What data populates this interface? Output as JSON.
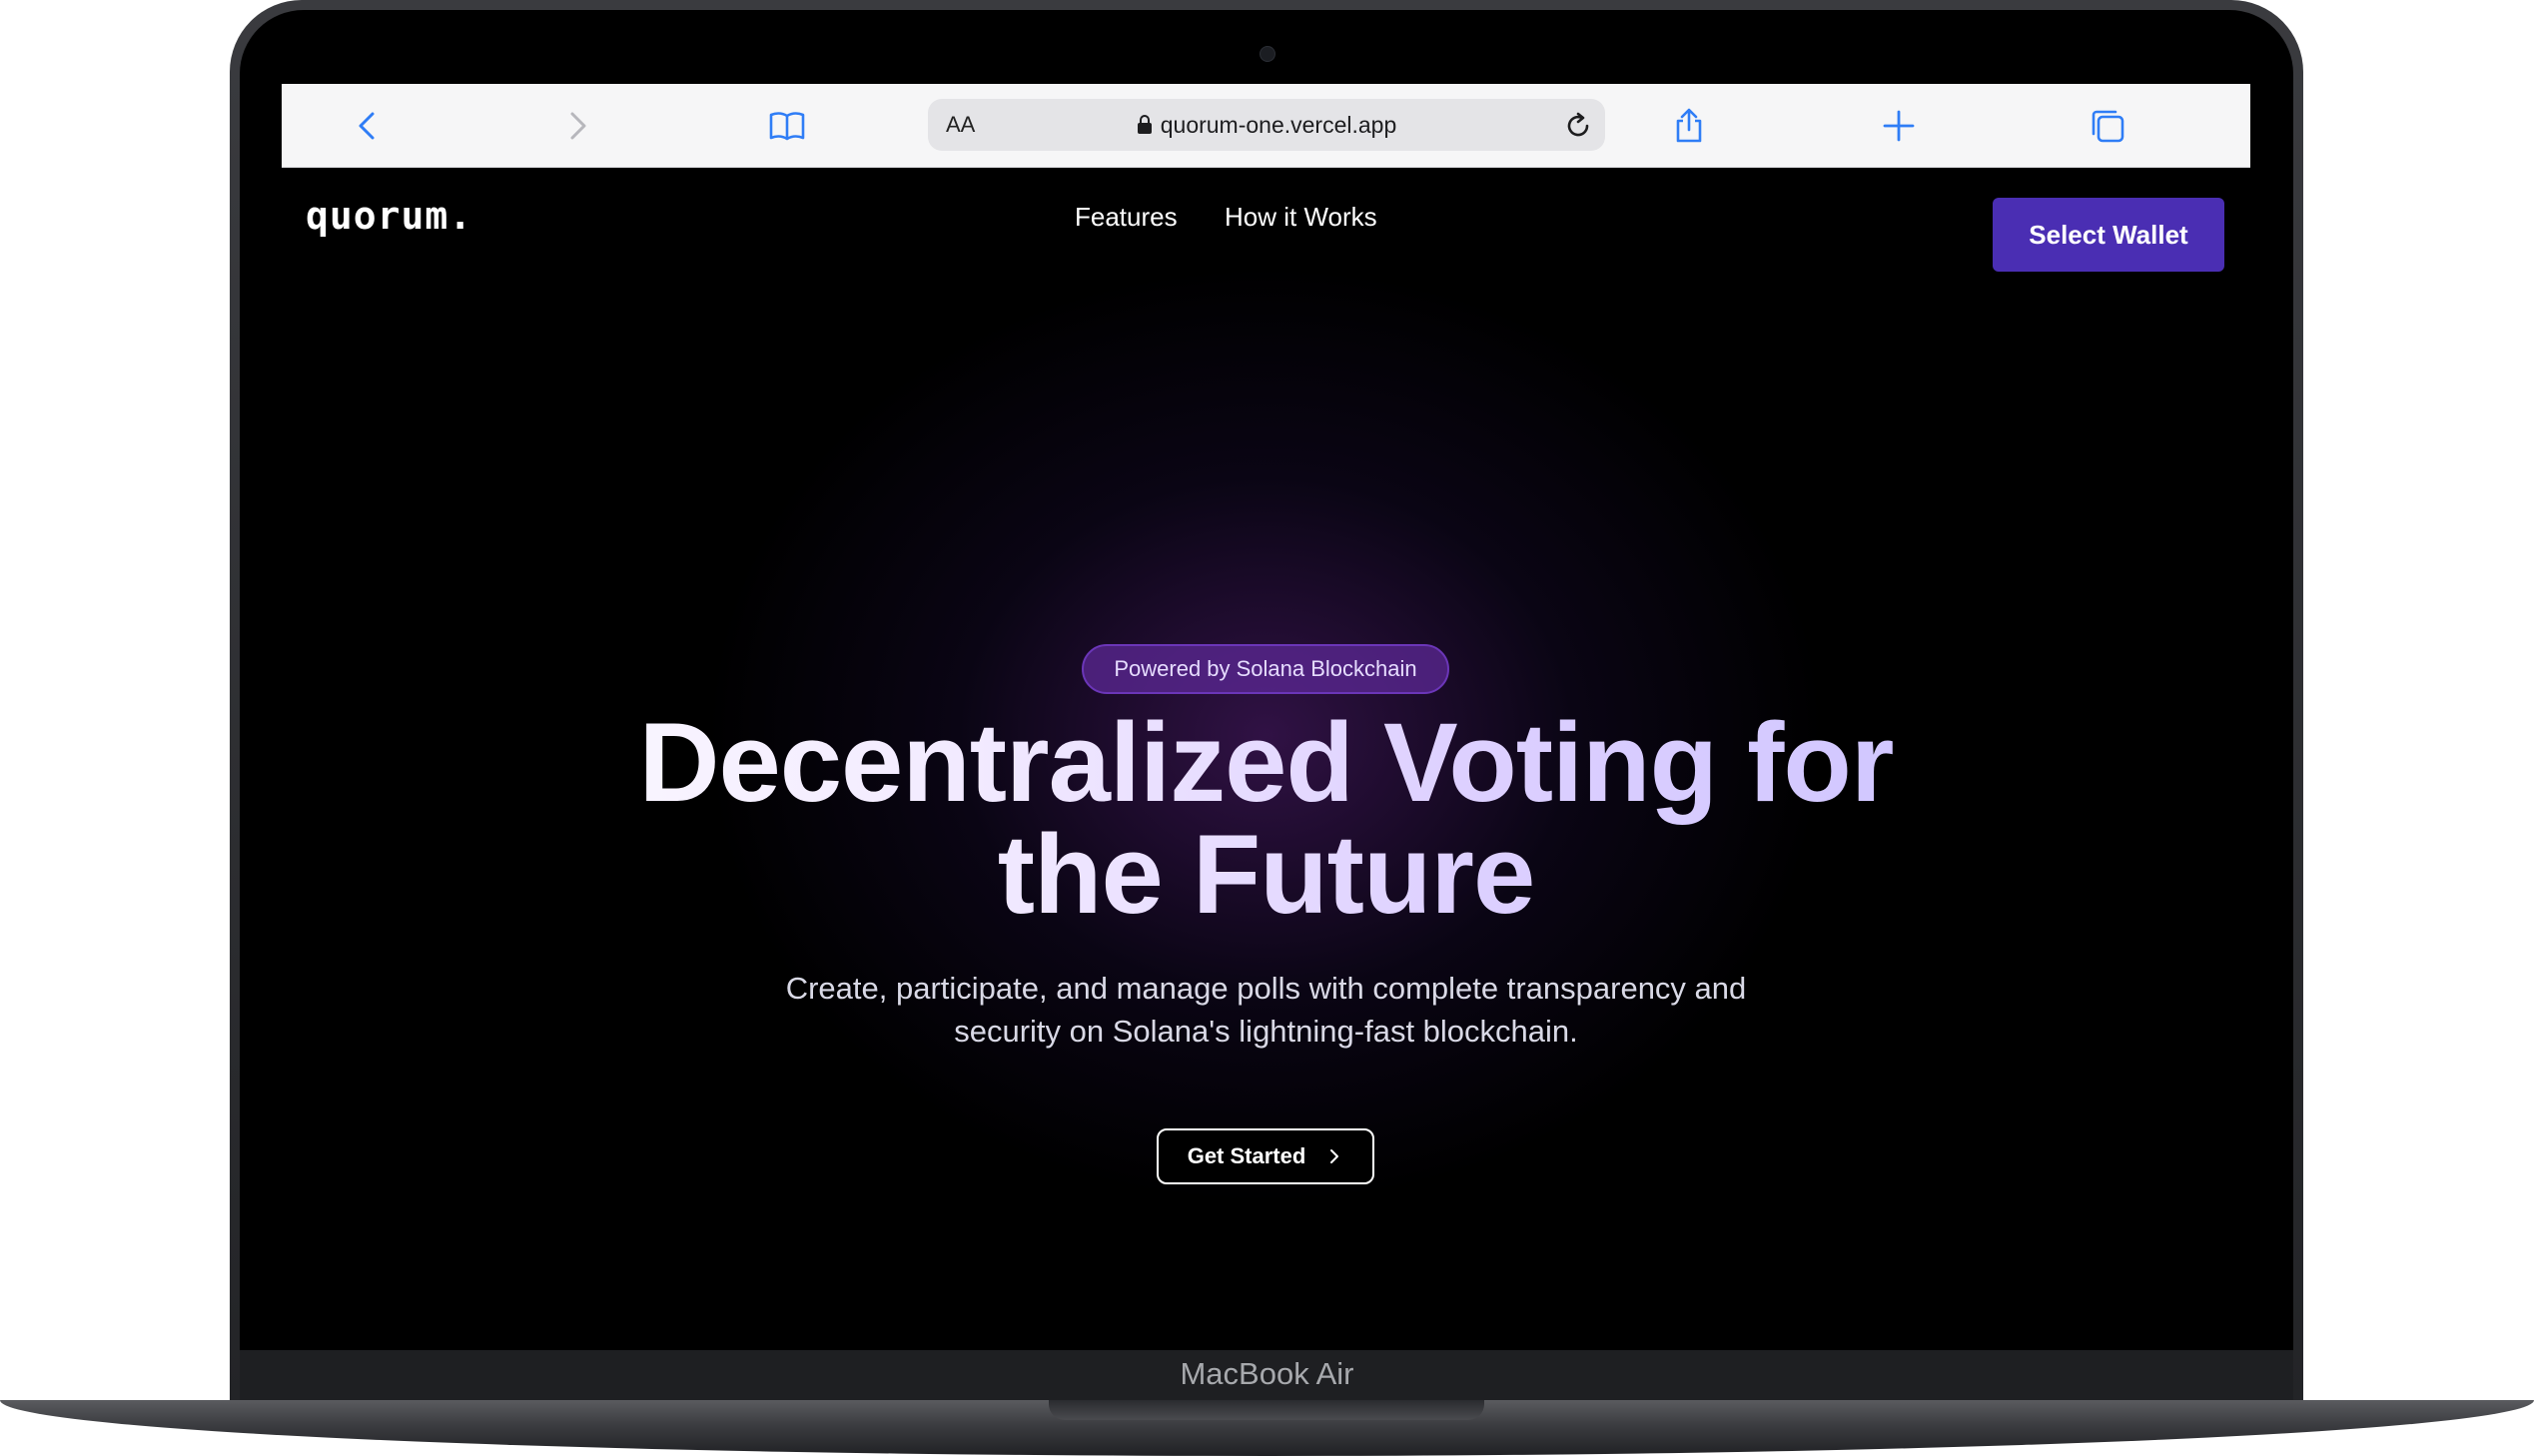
{
  "browser": {
    "text_size_label": "AA",
    "url": "quorum-one.vercel.app"
  },
  "site": {
    "logo": "quorum.",
    "nav": [
      {
        "label": "Features"
      },
      {
        "label": "How it Works"
      }
    ],
    "wallet_button": "Select Wallet"
  },
  "hero": {
    "badge": "Powered by Solana Blockchain",
    "headline_line1": "Decentralized Voting for",
    "headline_line2": "the Future",
    "subtitle": "Create, participate, and manage polls with complete transparency and security on Solana's lightning-fast blockchain.",
    "cta": "Get Started"
  },
  "device": {
    "label": "MacBook Air"
  },
  "colors": {
    "accent": "#4a2eb3",
    "badge_bg": "#5c2896",
    "safari_blue": "#2f7df6"
  }
}
